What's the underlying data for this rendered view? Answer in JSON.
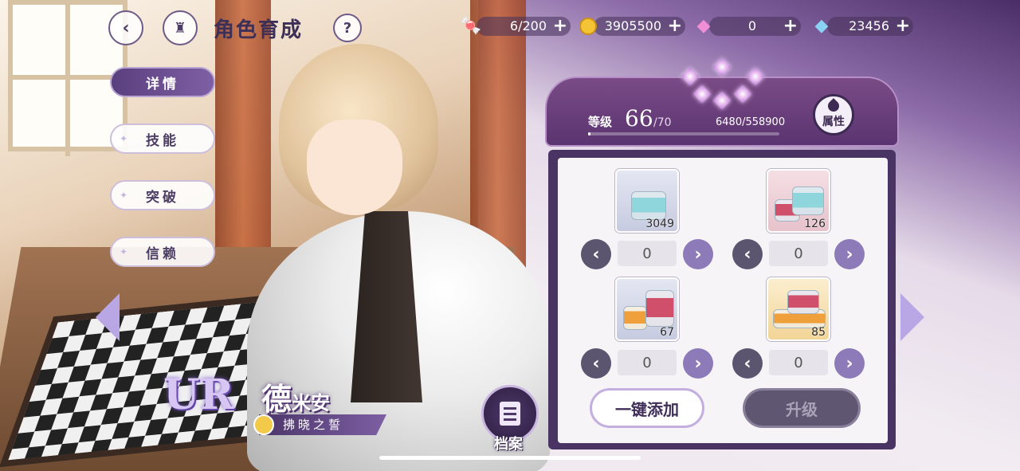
{
  "header": {
    "title": "角色育成",
    "back_icon": "back-arrow-icon",
    "home_icon": "castle-home-icon",
    "help_label": "?"
  },
  "resources": [
    {
      "name": "stamina",
      "icon": "candy-icon",
      "value": "6/200",
      "plus": "+"
    },
    {
      "name": "gold",
      "icon": "gold-coin-icon",
      "value": "3905500",
      "plus": "+"
    },
    {
      "name": "pink-gem",
      "icon": "pink-diamond-icon",
      "value": "0",
      "plus": "+"
    },
    {
      "name": "blue-gem",
      "icon": "blue-diamond-icon",
      "value": "23456",
      "plus": "+"
    }
  ],
  "menu": {
    "items": [
      {
        "label": "详情",
        "active": true
      },
      {
        "label": "技能",
        "active": false
      },
      {
        "label": "突破",
        "active": false
      },
      {
        "label": "信赖",
        "active": false
      }
    ]
  },
  "character": {
    "rarity": "UR",
    "name_main": "德",
    "name_small": "米安",
    "subtitle": "拂晓之誓"
  },
  "archive": {
    "label": "档案"
  },
  "level": {
    "label": "等级",
    "current": "66",
    "max": "/70",
    "exp_text": "6480/558900",
    "exp_fraction": 0.0116,
    "attribute_label": "属性",
    "stars": 6
  },
  "items": [
    {
      "count": "3049",
      "selected": "0",
      "prev": "‹",
      "next": "›"
    },
    {
      "count": "126",
      "selected": "0",
      "prev": "‹",
      "next": "›"
    },
    {
      "count": "67",
      "selected": "0",
      "prev": "‹",
      "next": "›"
    },
    {
      "count": "85",
      "selected": "0",
      "prev": "‹",
      "next": "›"
    }
  ],
  "actions": {
    "add_all": "一键添加",
    "upgrade": "升级"
  },
  "colors": {
    "accent_purple": "#5a3f7e",
    "panel_purple": "#4a3464",
    "upgrade_disabled": "#5f5672"
  }
}
